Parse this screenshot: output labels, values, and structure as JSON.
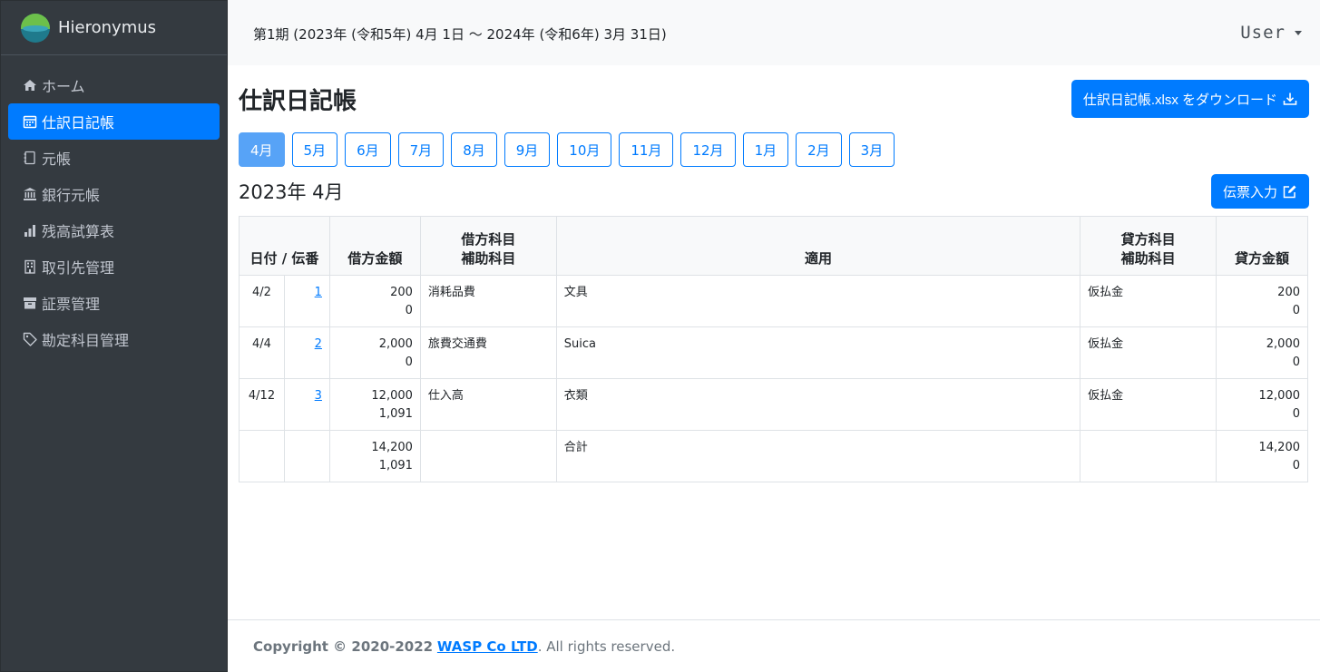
{
  "brand": {
    "name": "Hieronymus"
  },
  "sidebar": {
    "items": [
      {
        "label": "ホーム",
        "icon": "home-icon"
      },
      {
        "label": "仕訳日記帳",
        "icon": "calendar-icon",
        "active": true
      },
      {
        "label": "元帳",
        "icon": "book-icon"
      },
      {
        "label": "銀行元帳",
        "icon": "bank-icon"
      },
      {
        "label": "残高試算表",
        "icon": "bar-chart-icon"
      },
      {
        "label": "取引先管理",
        "icon": "building-icon"
      },
      {
        "label": "証票管理",
        "icon": "archive-icon"
      },
      {
        "label": "勘定科目管理",
        "icon": "tag-icon"
      }
    ]
  },
  "header": {
    "period": "第1期 (2023年 (令和5年) 4月 1日 〜 2024年 (令和6年) 3月 31日)",
    "user": "User"
  },
  "page": {
    "title": "仕訳日記帳",
    "download_label": "仕訳日記帳.xlsx をダウンロード",
    "months": [
      "4月",
      "5月",
      "6月",
      "7月",
      "8月",
      "9月",
      "10月",
      "11月",
      "12月",
      "1月",
      "2月",
      "3月"
    ],
    "active_month": "4月",
    "subtitle": "2023年 4月",
    "entry_label": "伝票入力"
  },
  "table": {
    "headers": {
      "date_slip": "日付 / 伝番",
      "debit_amount": "借方金額",
      "debit_account": "借方科目",
      "debit_sub": "補助科目",
      "summary": "適用",
      "credit_account": "貸方科目",
      "credit_sub": "補助科目",
      "credit_amount": "貸方金額"
    },
    "rows": [
      {
        "date": "4/2",
        "slip": "1",
        "debit_amount": "200",
        "debit_tax": "0",
        "debit_account": "消耗品費",
        "summary": "文具",
        "credit_account": "仮払金",
        "credit_amount": "200",
        "credit_tax": "0"
      },
      {
        "date": "4/4",
        "slip": "2",
        "debit_amount": "2,000",
        "debit_tax": "0",
        "debit_account": "旅費交通費",
        "summary": "Suica",
        "credit_account": "仮払金",
        "credit_amount": "2,000",
        "credit_tax": "0"
      },
      {
        "date": "4/12",
        "slip": "3",
        "debit_amount": "12,000",
        "debit_tax": "1,091",
        "debit_account": "仕入高",
        "summary": "衣類",
        "credit_account": "仮払金",
        "credit_amount": "12,000",
        "credit_tax": "0"
      }
    ],
    "total": {
      "debit_amount": "14,200",
      "debit_tax": "1,091",
      "label": "合計",
      "credit_amount": "14,200",
      "credit_tax": "0"
    }
  },
  "footer": {
    "prefix": "Copyright © 2020-2022 ",
    "company": "WASP Co LTD",
    "suffix": ". All rights reserved."
  },
  "colors": {
    "primary": "#007bff",
    "sidebar_bg": "#343a40",
    "active_month": "#57a3f7"
  }
}
